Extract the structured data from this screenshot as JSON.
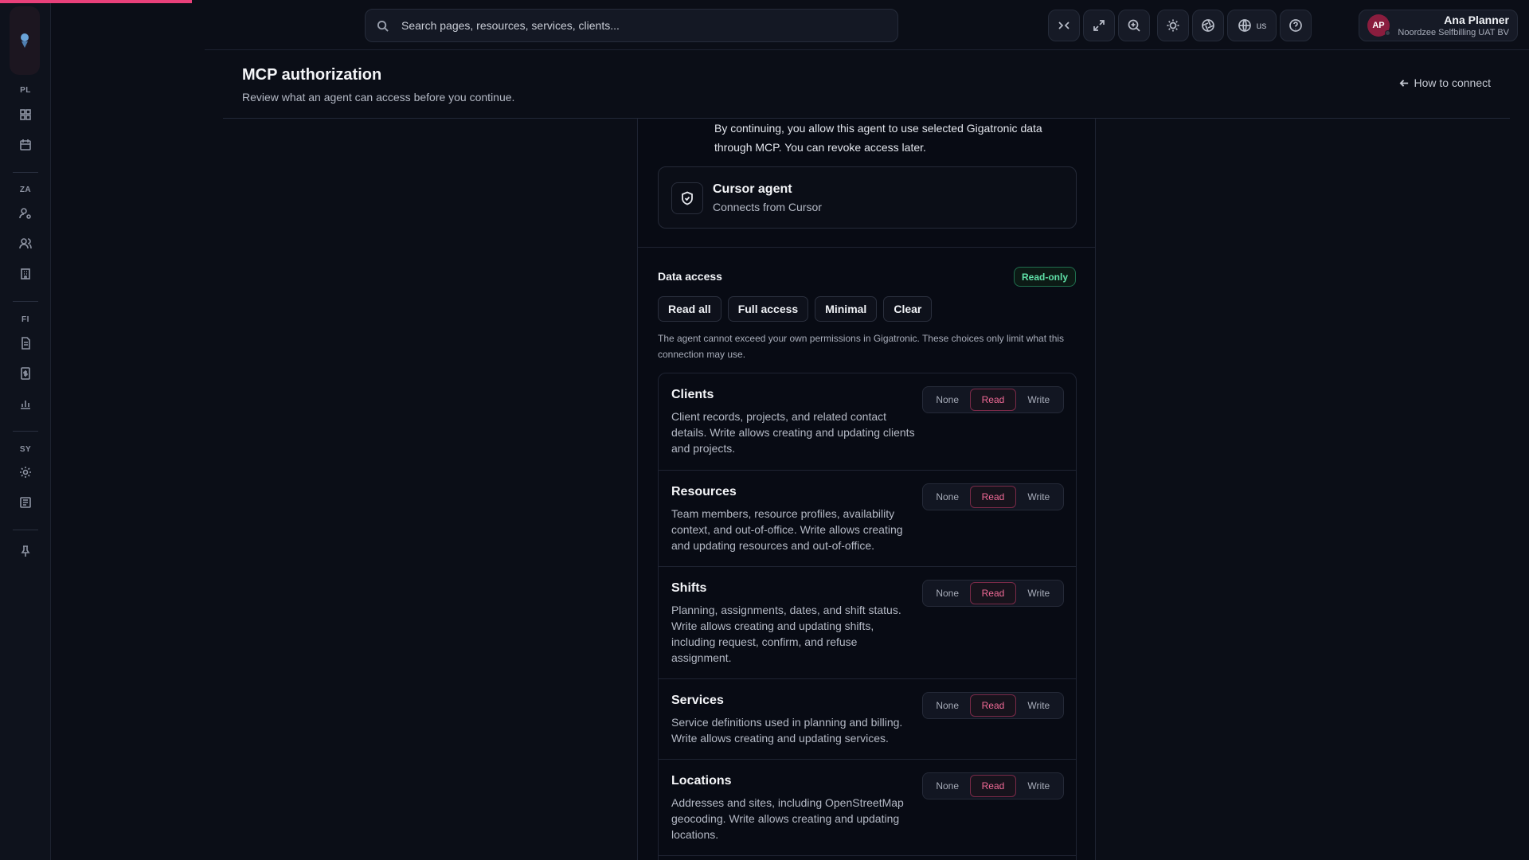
{
  "sidebar": {
    "sections": [
      {
        "label": "PL",
        "icons": [
          "dashboard-icon",
          "calendar-icon"
        ]
      },
      {
        "label": "ZA",
        "icons": [
          "user-cog-icon",
          "users-icon",
          "building-icon"
        ]
      },
      {
        "label": "FI",
        "icons": [
          "document-icon",
          "invoice-icon",
          "bar-chart-icon"
        ]
      },
      {
        "label": "SY",
        "icons": [
          "gear-icon",
          "list-icon"
        ]
      }
    ]
  },
  "topbar": {
    "search_placeholder": "Search pages, resources, services, clients...",
    "lang_code": "us",
    "user": {
      "initials": "AP",
      "name": "Ana Planner",
      "org": "Noordzee Selfbilling UAT BV"
    }
  },
  "header": {
    "title": "MCP authorization",
    "subtitle": "Review what an agent can access before you continue.",
    "how_link": "How to connect"
  },
  "consent": {
    "text": "By continuing, you allow this agent to use selected Gigatronic data through MCP. You can revoke access later."
  },
  "agent": {
    "name": "Cursor agent",
    "desc": "Connects from Cursor"
  },
  "data_access": {
    "title": "Data access",
    "badge": "Read-only",
    "presets": [
      "Read all",
      "Full access",
      "Minimal",
      "Clear"
    ],
    "note": "The agent cannot exceed your own permissions in Gigatronic. These choices only limit what this connection may use.",
    "options": [
      "None",
      "Read",
      "Write"
    ],
    "accent": "#f06a96",
    "permissions": [
      {
        "title": "Clients",
        "desc": "Client records, projects, and related contact details. Write allows creating and updating clients and projects.",
        "selected": "Read"
      },
      {
        "title": "Resources",
        "desc": "Team members, resource profiles, availability context, and out-of-office. Write allows creating and updating resources and out-of-office.",
        "selected": "Read"
      },
      {
        "title": "Shifts",
        "desc": "Planning, assignments, dates, and shift status. Write allows creating and updating shifts, including request, confirm, and refuse assignment.",
        "selected": "Read"
      },
      {
        "title": "Services",
        "desc": "Service definitions used in planning and billing. Write allows creating and updating services.",
        "selected": "Read"
      },
      {
        "title": "Locations",
        "desc": "Addresses and sites, including OpenStreetMap geocoding. Write allows creating and updating locations.",
        "selected": "Read"
      }
    ]
  }
}
